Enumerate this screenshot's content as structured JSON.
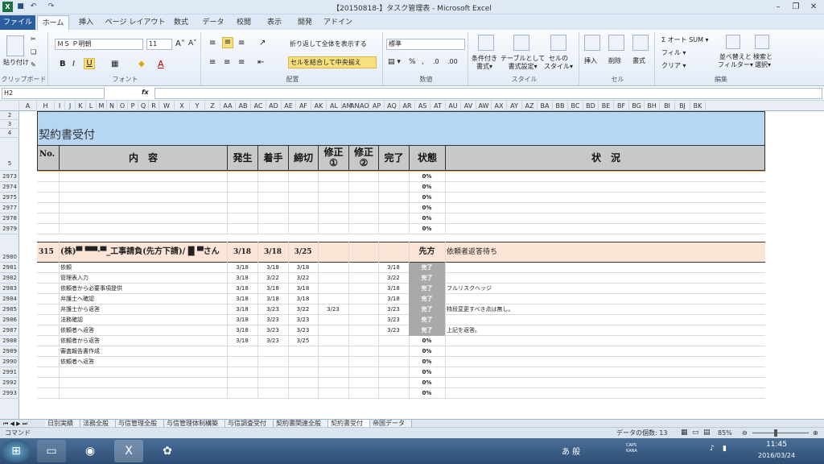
{
  "window": {
    "title": "【20150818-】タスク管理表 - Microsoft Excel",
    "excel_icon": "X"
  },
  "tabs": [
    "ファイル",
    "ホーム",
    "挿入",
    "ページ レイアウト",
    "数式",
    "データ",
    "校閲",
    "表示",
    "開発",
    "アドイン"
  ],
  "ribbon": {
    "paste": "貼り付け",
    "clipboard": "クリップボード",
    "font_name": "ＭＳ Ｐ明朝",
    "font_size": "11",
    "font_group": "フォント",
    "wrap": "折り返して全体を表示する",
    "merge": "セルを結合して中央揃え",
    "align_group": "配置",
    "number_format": "標準",
    "number_group": "数値",
    "cond": "条件付き\n書式▾",
    "table": "テーブルとして\n書式設定▾",
    "cellstyle": "セルの\nスタイル▾",
    "style_group": "スタイル",
    "insert": "挿入",
    "delete": "削除",
    "format": "書式",
    "cell_group": "セル",
    "autosum": "Σ オート SUM ▾",
    "fill": "フィル ▾",
    "clear": "クリア ▾",
    "sort": "並べ替えと\nフィルター▾",
    "find": "検索と\n選択▾",
    "edit_group": "編集"
  },
  "formula_bar": {
    "name_box": "H2",
    "fx": "fx",
    "value": ""
  },
  "columns": [
    "A",
    "H",
    "I",
    "J",
    "K",
    "L",
    "M",
    "N",
    "O",
    "P",
    "Q",
    "R",
    "W",
    "X",
    "Y",
    "Z",
    "AA",
    "AB",
    "AC",
    "AD",
    "AE",
    "AF",
    "AK",
    "AL",
    "AM",
    "AN",
    "AO",
    "AP",
    "AQ",
    "AR",
    "AS",
    "AT",
    "AU",
    "AV",
    "AW",
    "AX",
    "AY",
    "AZ",
    "BA",
    "BB",
    "BC",
    "BD",
    "BE",
    "BF",
    "BG",
    "BH",
    "BI",
    "BJ",
    "BK"
  ],
  "sheet": {
    "title": "契約書受付",
    "headers": {
      "no": "No.",
      "content": "内　容",
      "start": "発生",
      "begin": "着手",
      "deadline": "締切",
      "rev1": "修正\n①",
      "rev2": "修正\n②",
      "done": "完了",
      "state": "状態",
      "status": "状　況"
    },
    "top_rows": [
      {
        "n": "2"
      },
      {
        "n": "3"
      },
      {
        "n": "4"
      },
      {
        "n": "5"
      }
    ],
    "empty_rows": [
      {
        "n": "2973",
        "pct": "0%"
      },
      {
        "n": "2974",
        "pct": "0%"
      },
      {
        "n": "2975",
        "pct": "0%"
      },
      {
        "n": "2977",
        "pct": "0%"
      },
      {
        "n": "2978",
        "pct": "0%"
      },
      {
        "n": "2979",
        "pct": "0%"
      }
    ],
    "main_row": {
      "n": "2980",
      "no": "315",
      "content": "(株)▀ ▀▀·▀_工事請負(先方下請)/ █ ▀さん",
      "start": "3/18",
      "begin": "3/18",
      "deadline": "3/25",
      "state": "先方",
      "status": "依頼者返答待ち"
    },
    "rows": [
      {
        "n": "2981",
        "content": "依頼",
        "start": "3/18",
        "begin": "3/18",
        "deadline": "3/18",
        "rev1": "",
        "done": "3/18",
        "state": "完了",
        "status": ""
      },
      {
        "n": "2982",
        "content": "管理表入力",
        "start": "3/18",
        "begin": "3/22",
        "deadline": "3/22",
        "rev1": "",
        "done": "3/22",
        "state": "完了",
        "status": ""
      },
      {
        "n": "2983",
        "content": "依頼者から必要事項提供",
        "start": "3/18",
        "begin": "3/18",
        "deadline": "3/18",
        "rev1": "",
        "done": "3/18",
        "state": "完了",
        "status": "フルリスクヘッジ"
      },
      {
        "n": "2984",
        "content": "弁護士へ確認",
        "start": "3/18",
        "begin": "3/18",
        "deadline": "3/18",
        "rev1": "",
        "done": "3/18",
        "state": "完了",
        "status": ""
      },
      {
        "n": "2985",
        "content": "弁護士から返答",
        "start": "3/18",
        "begin": "3/23",
        "deadline": "3/22",
        "rev1": "3/23",
        "done": "3/23",
        "state": "完了",
        "status": "特段変更すべき点は無し。"
      },
      {
        "n": "2986",
        "content": "法務確認",
        "start": "3/18",
        "begin": "3/23",
        "deadline": "3/23",
        "rev1": "",
        "done": "3/23",
        "state": "完了",
        "status": ""
      },
      {
        "n": "2987",
        "content": "依頼者へ返答",
        "start": "3/18",
        "begin": "3/23",
        "deadline": "3/23",
        "rev1": "",
        "done": "3/23",
        "state": "完了",
        "status": "上記を返答。"
      },
      {
        "n": "2988",
        "content": "依頼者から返答",
        "start": "3/18",
        "begin": "3/23",
        "deadline": "3/25",
        "rev1": "",
        "done": "",
        "state": "0%",
        "status": ""
      },
      {
        "n": "2989",
        "content": "審査報告書作成",
        "start": "",
        "begin": "",
        "deadline": "",
        "rev1": "",
        "done": "",
        "state": "0%",
        "status": ""
      },
      {
        "n": "2990",
        "content": "依頼者へ返答",
        "start": "",
        "begin": "",
        "deadline": "",
        "rev1": "",
        "done": "",
        "state": "0%",
        "status": ""
      },
      {
        "n": "2991",
        "content": "",
        "start": "",
        "begin": "",
        "deadline": "",
        "rev1": "",
        "done": "",
        "state": "0%",
        "status": ""
      },
      {
        "n": "2992",
        "content": "",
        "start": "",
        "begin": "",
        "deadline": "",
        "rev1": "",
        "done": "",
        "state": "0%",
        "status": ""
      },
      {
        "n": "2993",
        "content": "",
        "start": "",
        "begin": "",
        "deadline": "",
        "rev1": "",
        "done": "",
        "state": "0%",
        "status": ""
      }
    ]
  },
  "sheet_tabs": [
    "日別実績",
    "法務全般",
    "与信管理全般",
    "与信管理体制構築",
    "与信調査受付",
    "契約書関連全般",
    "契約書受付",
    "帝国データ"
  ],
  "status_bar": {
    "mode": "コマンド",
    "count": "データの個数: 13",
    "zoom": "85%"
  },
  "taskbar": {
    "time": "11:45",
    "date": "2016/03/24",
    "ime": "あ 般",
    "caps": "CAPS\nKANA"
  }
}
